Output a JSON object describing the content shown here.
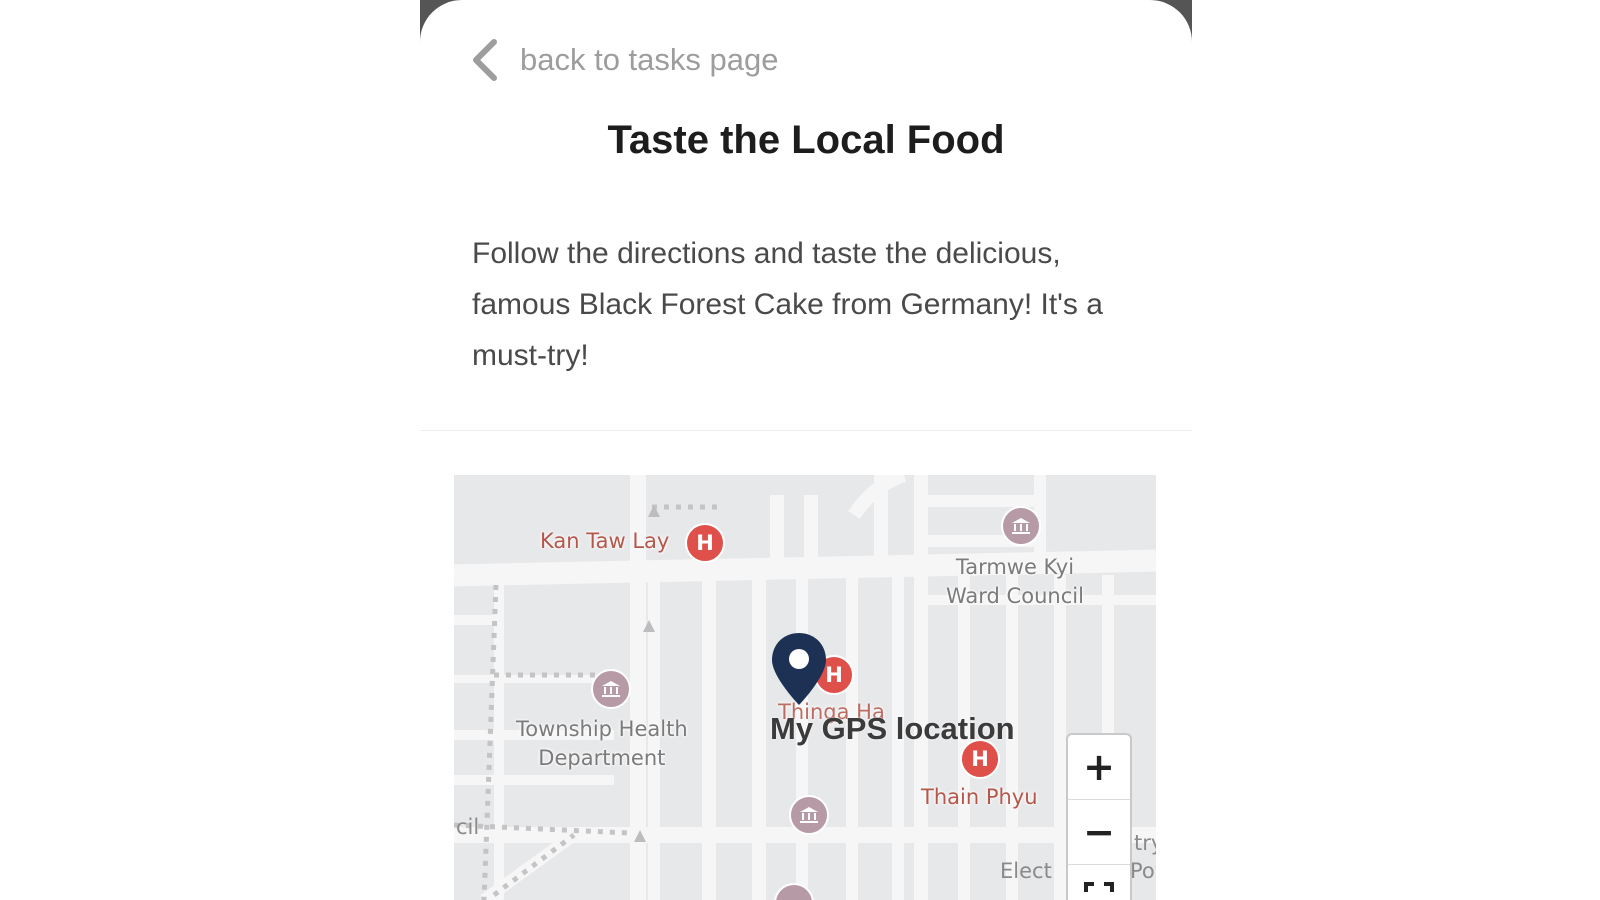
{
  "header": {
    "back_label": "back to tasks page",
    "back_icon": "chevron-left-icon"
  },
  "task": {
    "title": "Taste the Local Food",
    "description": "Follow the directions and taste the delicious, famous Black Forest Cake from Germany! It's a must-try!"
  },
  "map": {
    "gps_label": "My GPS location",
    "zoom_in_label": "+",
    "zoom_out_label": "−",
    "pin_color": "#1c3153",
    "pois": {
      "kan_taw_lay": "Kan Taw Lay",
      "tarmwe_line1": "Tarmwe Kyi",
      "tarmwe_line2": "Ward Council",
      "township_line1": "Township Health",
      "township_line2": "Department",
      "thain_phyu": "Thain Phyu",
      "thinga": "Thinga Ha"
    },
    "edge_labels": {
      "cil": "cil",
      "elect": "Elect",
      "try": "try",
      "pow": "Pow"
    },
    "marker_letter": "H",
    "hospital_color": "#e0504a",
    "government_color": "#b69aa6"
  }
}
